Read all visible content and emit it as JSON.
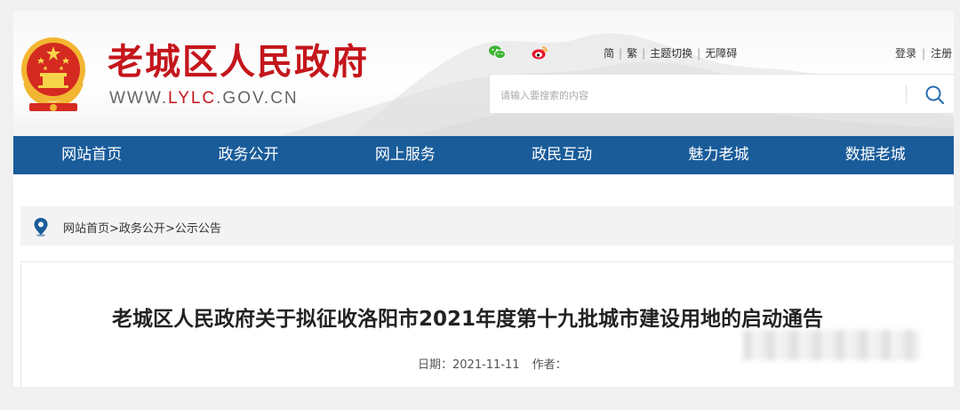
{
  "header": {
    "site_title": "老城区人民政府",
    "domain_prefix": "WWW.",
    "domain_highlight": "LYLC",
    "domain_suffix": ".GOV.CN",
    "util_links": [
      "简",
      "繁",
      "主题切换",
      "无障碍"
    ],
    "login_links": [
      "登录",
      "注册"
    ],
    "search_placeholder": "请输入要搜索的内容",
    "social_icons": [
      "wechat-icon",
      "weibo-icon"
    ]
  },
  "nav": {
    "items": [
      "网站首页",
      "政务公开",
      "网上服务",
      "政民互动",
      "魅力老城",
      "数据老城"
    ]
  },
  "breadcrumb": {
    "items": [
      "网站首页",
      "政务公开",
      "公示公告"
    ],
    "separator": ">"
  },
  "article": {
    "title": "老城区人民政府关于拟征收洛阳市2021年度第十九批城市建设用地的启动通告",
    "date_label": "日期：",
    "date": "2021-11-11",
    "author_label": "作者："
  },
  "colors": {
    "brand_red": "#c4161c",
    "nav_blue": "#1a5c9a"
  }
}
